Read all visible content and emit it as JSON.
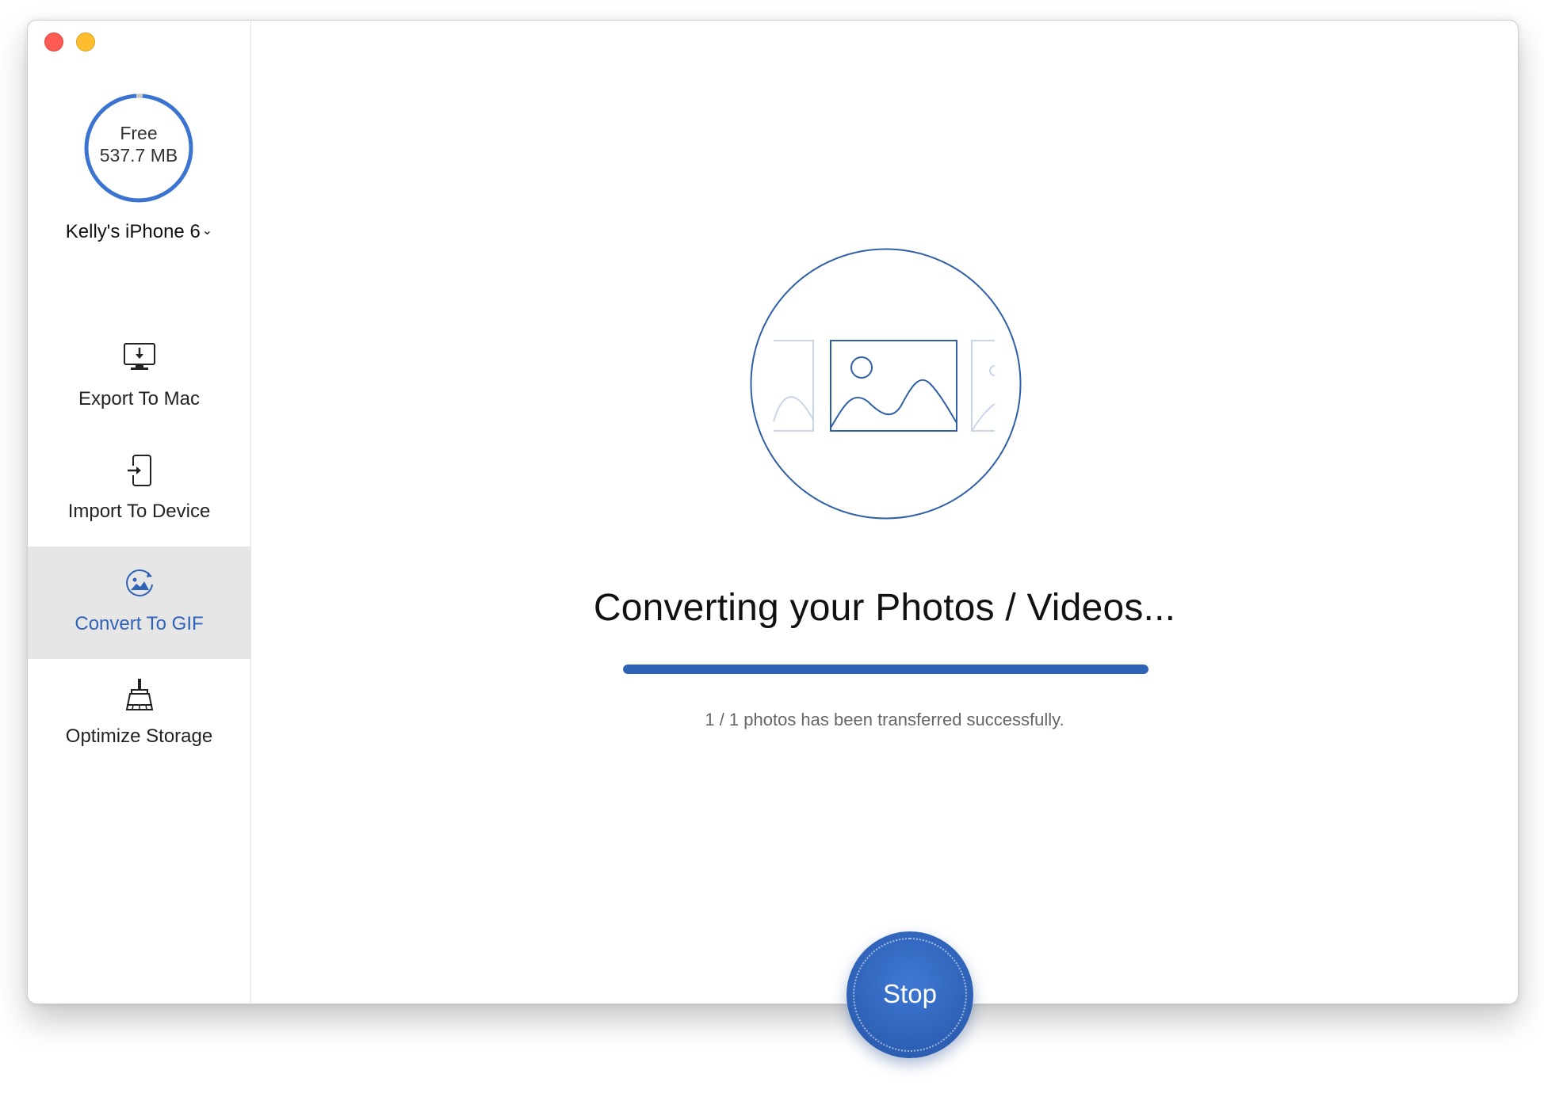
{
  "window": {
    "controls": [
      "close",
      "minimize"
    ]
  },
  "sidebar": {
    "storage": {
      "label": "Free",
      "value": "537.7 MB",
      "used_fraction": 0.02,
      "ring_color": "#3a74d0",
      "used_color": "#c8c8c8"
    },
    "device": {
      "name": "Kelly's iPhone 6",
      "chevron": "⌄"
    },
    "items": [
      {
        "label": "Export To Mac",
        "icon": "monitor-download-icon",
        "active": false
      },
      {
        "label": "Import To Device",
        "icon": "phone-import-icon",
        "active": false
      },
      {
        "label": "Convert To GIF",
        "icon": "gif-convert-icon",
        "active": true
      },
      {
        "label": "Optimize Storage",
        "icon": "broom-icon",
        "active": false
      }
    ]
  },
  "main": {
    "headline": "Converting your Photos / Videos...",
    "progress": 1.0,
    "status": "1 / 1 photos has been transferred successfully.",
    "stop_label": "Stop"
  },
  "colors": {
    "accent": "#2f63b8",
    "active_bg": "#e6e6e6"
  }
}
